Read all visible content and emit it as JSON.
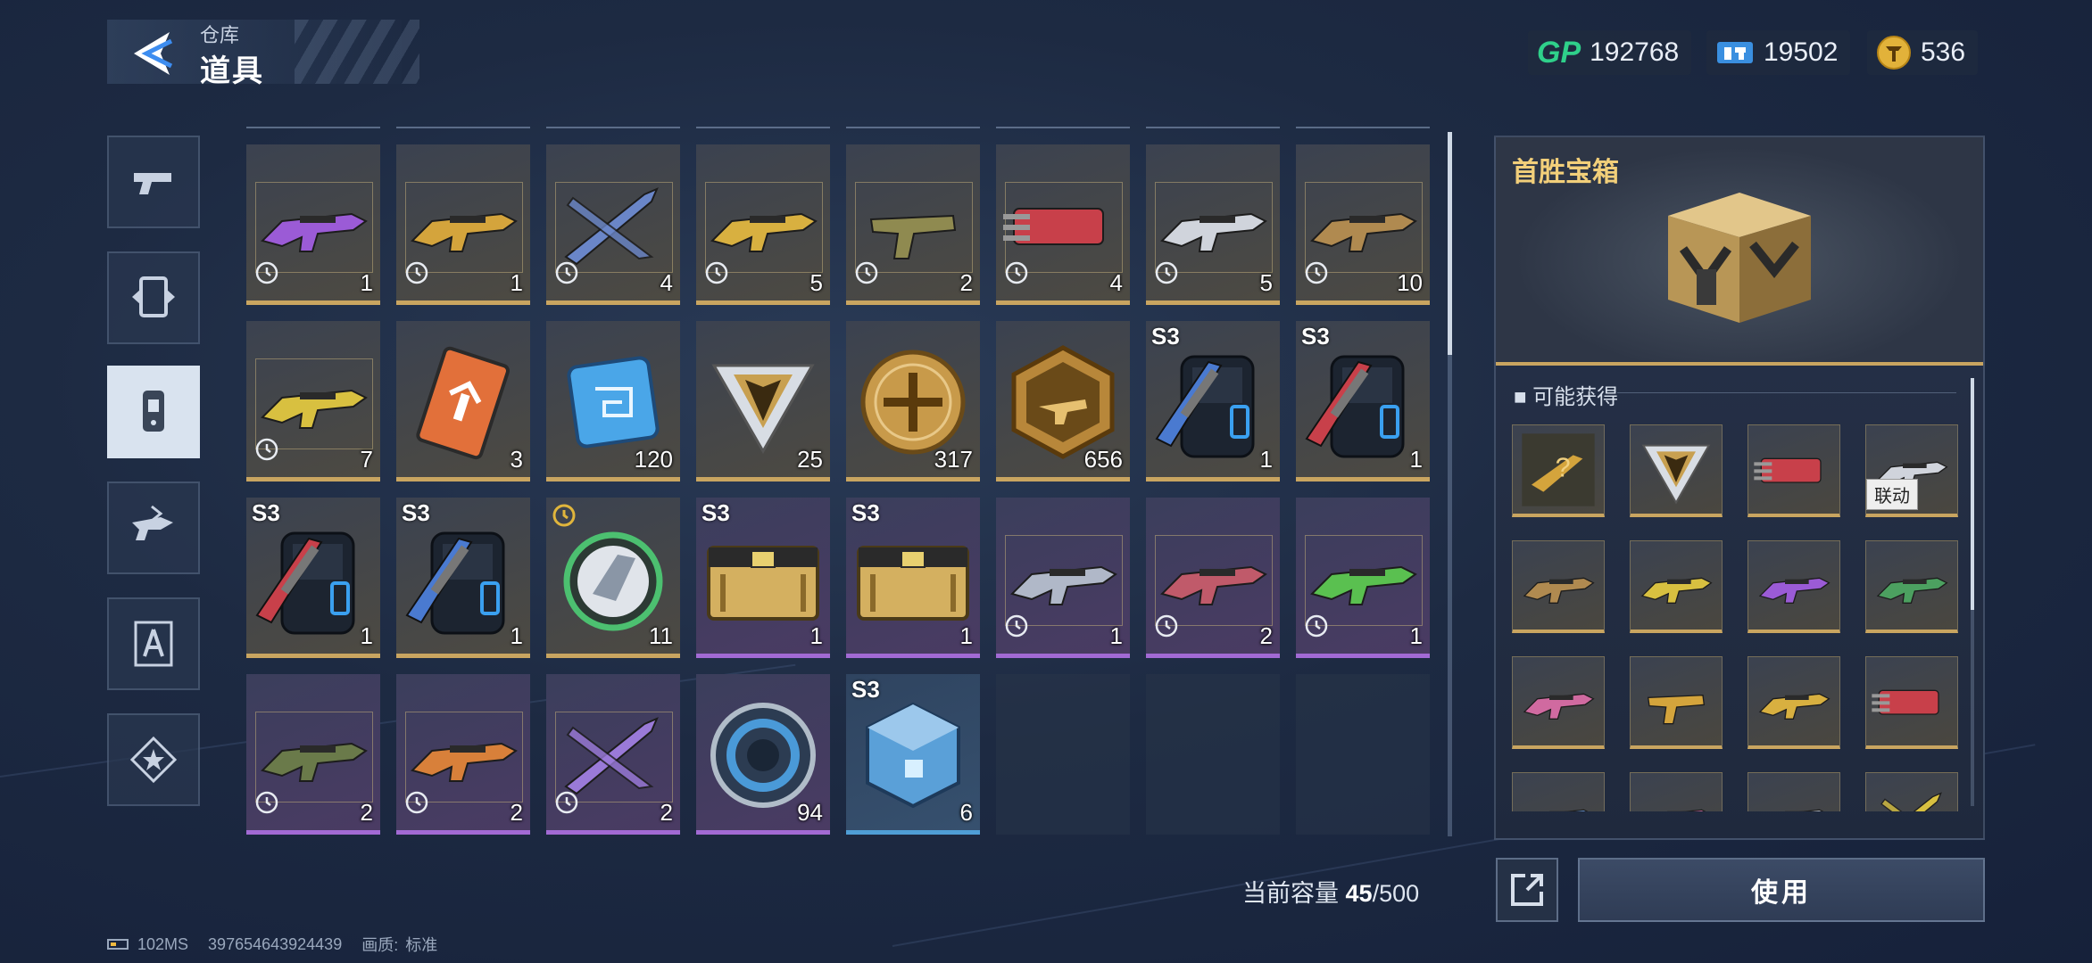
{
  "header": {
    "subtitle": "仓库",
    "title": "道具"
  },
  "currencies": [
    {
      "name": "gp-icon",
      "label": "GP",
      "value": "192768"
    },
    {
      "name": "ticket-icon",
      "value": "19502"
    },
    {
      "name": "coin-icon",
      "value": "536"
    }
  ],
  "tabs": [
    {
      "name": "tab-weapons",
      "icon": "pistol-icon",
      "active": false
    },
    {
      "name": "tab-cards",
      "icon": "card-icon",
      "active": false
    },
    {
      "name": "tab-items",
      "icon": "tag-icon",
      "active": true
    },
    {
      "name": "tab-skins",
      "icon": "gun-skin-icon",
      "active": false
    },
    {
      "name": "tab-tools",
      "icon": "compass-icon",
      "active": false
    },
    {
      "name": "tab-favorites",
      "icon": "star-icon",
      "active": false
    }
  ],
  "items": [
    {
      "art": "rifle",
      "color": "#9b5bd6",
      "count": "1",
      "clock": true,
      "rarity": "gold"
    },
    {
      "art": "rifle",
      "color": "#d4a43c",
      "count": "1",
      "clock": true,
      "rarity": "gold"
    },
    {
      "art": "knife",
      "color": "#6a86c8",
      "count": "4",
      "clock": true,
      "rarity": "gold"
    },
    {
      "art": "rifle",
      "color": "#d8b040",
      "count": "5",
      "clock": true,
      "rarity": "gold"
    },
    {
      "art": "pistol",
      "color": "#8f8a50",
      "count": "2",
      "clock": true,
      "rarity": "gold"
    },
    {
      "art": "gatling",
      "color": "#c8404a",
      "count": "4",
      "clock": true,
      "rarity": "gold"
    },
    {
      "art": "rifle",
      "color": "#d0d4dc",
      "count": "5",
      "clock": true,
      "rarity": "gold"
    },
    {
      "art": "rifle",
      "color": "#b08a50",
      "count": "10",
      "clock": true,
      "rarity": "gold"
    },
    {
      "art": "rifle",
      "color": "#d8c040",
      "count": "7",
      "clock": true,
      "rarity": "gold"
    },
    {
      "art": "card",
      "color": "#e2703a",
      "count": "3",
      "rarity": "gold"
    },
    {
      "art": "chip",
      "color": "#4aa6e8",
      "count": "120",
      "rarity": "gold"
    },
    {
      "art": "triangle",
      "color": "#c8a050",
      "count": "25",
      "rarity": "gold"
    },
    {
      "art": "medal",
      "color": "#c89a4a",
      "count": "317",
      "rarity": "gold"
    },
    {
      "art": "hexbadge",
      "color": "#b8873a",
      "count": "656",
      "rarity": "gold"
    },
    {
      "art": "backpack",
      "color": "#4a7ad0",
      "count": "1",
      "season": "S3",
      "rarity": "gold"
    },
    {
      "art": "backpack",
      "color": "#c8404a",
      "count": "1",
      "season": "S3",
      "rarity": "gold"
    },
    {
      "art": "backpack",
      "color": "#c8404a",
      "count": "1",
      "season": "S3",
      "rarity": "gold"
    },
    {
      "art": "backpack",
      "color": "#4a7ad0",
      "count": "1",
      "season": "S3",
      "rarity": "gold"
    },
    {
      "art": "emblem",
      "color": "#4cc070",
      "count": "11",
      "timerTop": true,
      "rarity": "gold"
    },
    {
      "art": "chest",
      "color": "#d4b060",
      "count": "1",
      "season": "S3",
      "rarity": "purple"
    },
    {
      "art": "chest",
      "color": "#d4b060",
      "count": "1",
      "season": "S3",
      "rarity": "purple"
    },
    {
      "art": "rifle",
      "color": "#b0b8c8",
      "count": "1",
      "clock": true,
      "rarity": "purple"
    },
    {
      "art": "rifle",
      "color": "#c05a6a",
      "count": "2",
      "clock": true,
      "rarity": "purple"
    },
    {
      "art": "rifle",
      "color": "#5ac050",
      "count": "1",
      "clock": true,
      "rarity": "purple"
    },
    {
      "art": "rifle",
      "color": "#6a7a4a",
      "count": "2",
      "clock": true,
      "rarity": "purple"
    },
    {
      "art": "rifle",
      "color": "#d8803a",
      "count": "2",
      "clock": true,
      "rarity": "purple"
    },
    {
      "art": "knife",
      "color": "#9a7ad8",
      "count": "2",
      "clock": true,
      "rarity": "purple"
    },
    {
      "art": "ring",
      "color": "#4a9ad8",
      "count": "94",
      "rarity": "purple"
    },
    {
      "art": "cube",
      "color": "#5aa0d8",
      "count": "6",
      "season": "S3",
      "rarity": "blue"
    },
    {
      "empty": true
    },
    {
      "empty": true
    },
    {
      "empty": true
    }
  ],
  "capacity": {
    "label": "当前容量",
    "current": "45",
    "max": "/500"
  },
  "detail": {
    "title": "首胜宝箱",
    "section": "可能获得",
    "use_label": "使用",
    "rewards": [
      {
        "art": "mystery",
        "color": "#d4a43c"
      },
      {
        "art": "triangle",
        "color": "#c8a050"
      },
      {
        "art": "gatling",
        "color": "#c8404a"
      },
      {
        "art": "rifle",
        "color": "#d0d4dc",
        "badge": "联动"
      },
      {
        "art": "rifle",
        "color": "#b08a50"
      },
      {
        "art": "rifle",
        "color": "#d8c040"
      },
      {
        "art": "rifle",
        "color": "#9b5bd6"
      },
      {
        "art": "rifle",
        "color": "#4ca060"
      },
      {
        "art": "rifle",
        "color": "#d06aa0"
      },
      {
        "art": "pistol",
        "color": "#d4a43c"
      },
      {
        "art": "rifle",
        "color": "#d8b040"
      },
      {
        "art": "gatling",
        "color": "#c8404a"
      },
      {
        "art": "rifle",
        "color": "#6a9ad8"
      },
      {
        "art": "rifle",
        "color": "#d06aa0"
      },
      {
        "art": "rifle",
        "color": "#c0c4cc"
      },
      {
        "art": "knife",
        "color": "#d8c040"
      }
    ]
  },
  "footer": {
    "ping": "102MS",
    "uid": "397654643924439",
    "quality_label": "画质:",
    "quality_value": "标准"
  }
}
